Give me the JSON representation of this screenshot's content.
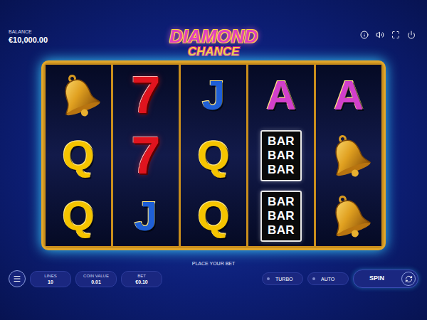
{
  "balance": {
    "label": "BALANCE",
    "value": "€10,000.00"
  },
  "logo": {
    "top": "DIAMOND",
    "bottom": "CHANCE"
  },
  "reels": [
    [
      {
        "kind": "bell"
      },
      {
        "kind": "letter",
        "text": "Q",
        "color": "#f5c400"
      },
      {
        "kind": "letter",
        "text": "Q",
        "color": "#f5c400"
      }
    ],
    [
      {
        "kind": "seven",
        "text": "7",
        "color": "#e0141e"
      },
      {
        "kind": "seven",
        "text": "7",
        "color": "#e0141e"
      },
      {
        "kind": "letter",
        "text": "J",
        "color": "#1f5fd6"
      }
    ],
    [
      {
        "kind": "letter",
        "text": "J",
        "color": "#1f5fd6"
      },
      {
        "kind": "letter",
        "text": "Q",
        "color": "#f5c400"
      },
      {
        "kind": "letter",
        "text": "Q",
        "color": "#f5c400"
      }
    ],
    [
      {
        "kind": "letter",
        "text": "A",
        "color": "#d23fcb"
      },
      {
        "kind": "bar",
        "lines": [
          "BAR",
          "BAR",
          "BAR"
        ]
      },
      {
        "kind": "bar",
        "lines": [
          "BAR",
          "BAR",
          "BAR"
        ]
      }
    ],
    [
      {
        "kind": "letter",
        "text": "A",
        "color": "#d23fcb"
      },
      {
        "kind": "bell"
      },
      {
        "kind": "bell"
      }
    ]
  ],
  "status": "PLACE YOUR BET",
  "bet_fields": [
    {
      "label": "LINES",
      "value": "10"
    },
    {
      "label": "COIN VALUE",
      "value": "0.01"
    },
    {
      "label": "BET",
      "value": "€0.10"
    }
  ],
  "toggles": [
    {
      "label": "TURBO",
      "on": false
    },
    {
      "label": "AUTO",
      "on": false
    }
  ],
  "spin_button": {
    "label": "SPIN"
  }
}
